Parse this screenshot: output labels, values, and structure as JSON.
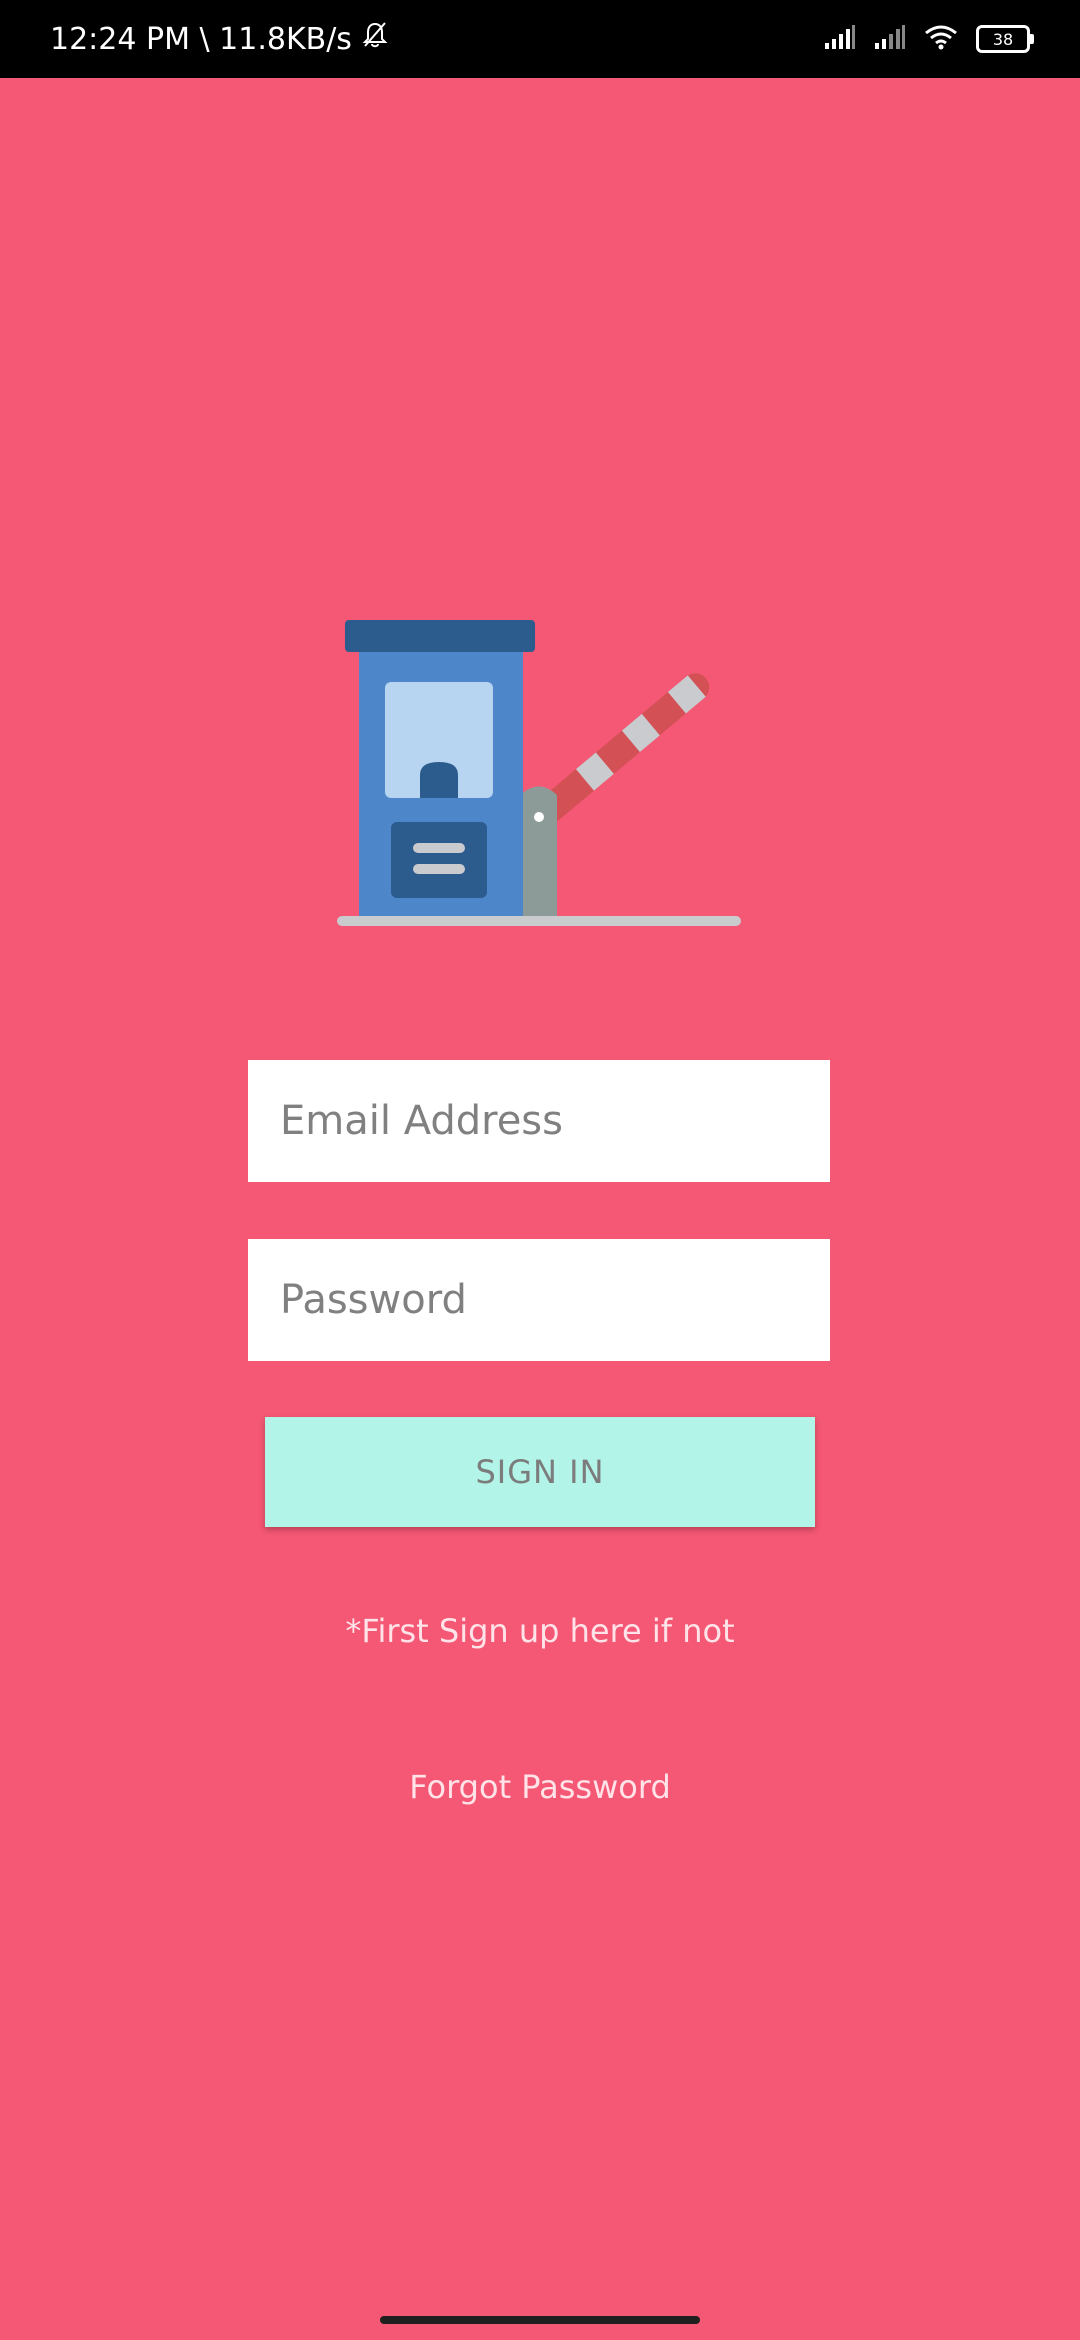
{
  "status_bar": {
    "time_speed": "12:24 PM \\ 11.8KB/s",
    "battery": "38",
    "icons": [
      "mute-bell-icon",
      "signal-icon",
      "signal-icon",
      "wifi-icon",
      "battery-icon"
    ]
  },
  "logo": {
    "icon": "toll-booth-barrier-icon"
  },
  "form": {
    "email_placeholder": "Email Address",
    "password_placeholder": "Password",
    "signin_label": "SIGN IN"
  },
  "links": {
    "signup_hint": "*First Sign up here if not",
    "forgot_password": "Forgot Password"
  },
  "colors": {
    "background": "#F55874",
    "button": "#B2F4E7"
  }
}
